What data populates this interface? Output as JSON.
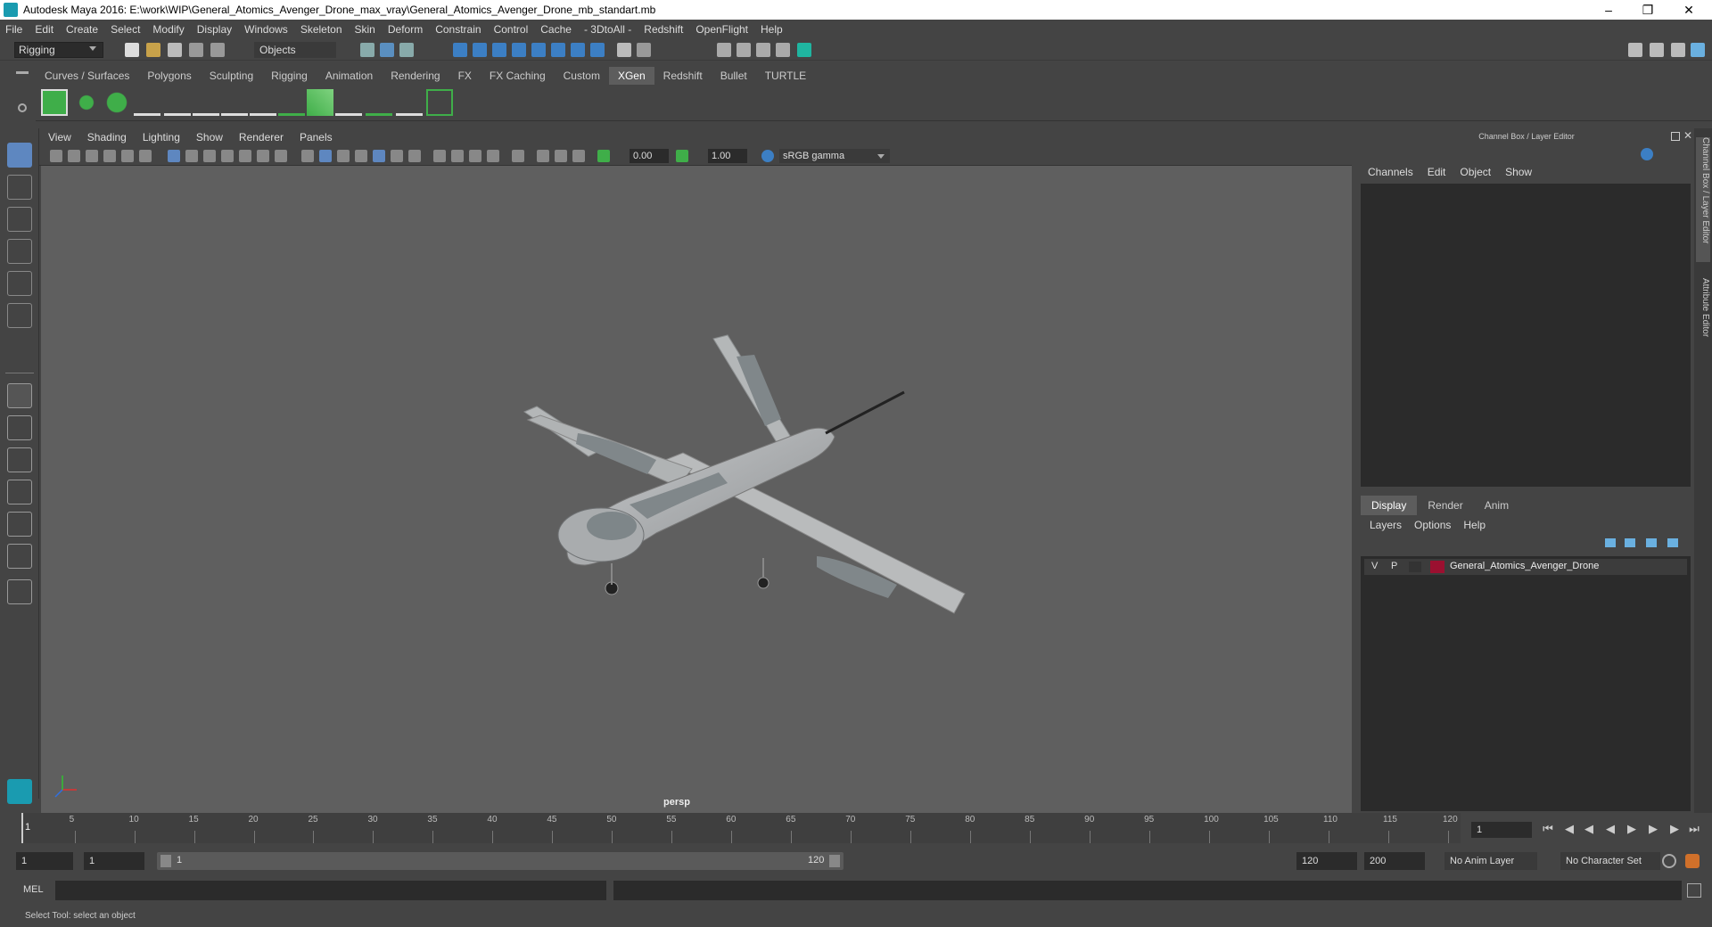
{
  "window": {
    "title": "Autodesk Maya 2016: E:\\work\\WIP\\General_Atomics_Avenger_Drone_max_vray\\General_Atomics_Avenger_Drone_mb_standart.mb"
  },
  "menubar": [
    "File",
    "Edit",
    "Create",
    "Select",
    "Modify",
    "Display",
    "Windows",
    "Skeleton",
    "Skin",
    "Deform",
    "Constrain",
    "Control",
    "Cache",
    "- 3DtoAll -",
    "Redshift",
    "OpenFlight",
    "Help"
  ],
  "statusline": {
    "mode": "Rigging",
    "objects_label": "Objects"
  },
  "shelf_tabs": [
    {
      "label": "Curves / Surfaces",
      "active": false
    },
    {
      "label": "Polygons",
      "active": false
    },
    {
      "label": "Sculpting",
      "active": false
    },
    {
      "label": "Rigging",
      "active": false
    },
    {
      "label": "Animation",
      "active": false
    },
    {
      "label": "Rendering",
      "active": false
    },
    {
      "label": "FX",
      "active": false
    },
    {
      "label": "FX Caching",
      "active": false
    },
    {
      "label": "Custom",
      "active": false
    },
    {
      "label": "XGen",
      "active": true
    },
    {
      "label": "Redshift",
      "active": false
    },
    {
      "label": "Bullet",
      "active": false
    },
    {
      "label": "TURTLE",
      "active": false
    }
  ],
  "viewport": {
    "menu": [
      "View",
      "Shading",
      "Lighting",
      "Show",
      "Renderer",
      "Panels"
    ],
    "exposure": "0.00",
    "gamma": "1.00",
    "colorspace": "sRGB gamma",
    "camera": "persp"
  },
  "right_panel": {
    "title": "Channel Box / Layer Editor",
    "menu": [
      "Channels",
      "Edit",
      "Object",
      "Show"
    ],
    "layer_tabs": [
      {
        "label": "Display",
        "active": true
      },
      {
        "label": "Render",
        "active": false
      },
      {
        "label": "Anim",
        "active": false
      }
    ],
    "layer_menu": [
      "Layers",
      "Options",
      "Help"
    ],
    "layer": {
      "v": "V",
      "p": "P",
      "name": "General_Atomics_Avenger_Drone",
      "color": "#9b1030"
    },
    "side_tabs": [
      "Channel Box / Layer Editor",
      "Attribute Editor"
    ]
  },
  "timeline": {
    "ticks": [
      "5",
      "10",
      "15",
      "20",
      "25",
      "30",
      "35",
      "40",
      "45",
      "50",
      "55",
      "60",
      "65",
      "70",
      "75",
      "80",
      "85",
      "90",
      "95",
      "100",
      "105",
      "110",
      "115",
      "120"
    ],
    "start_label": "1",
    "current_frame": "1"
  },
  "range": {
    "start": "1",
    "anim_start": "1",
    "slider_start": "1",
    "slider_end": "120",
    "anim_end": "120",
    "end": "200",
    "anim_layer": "No Anim Layer",
    "char_set": "No Character Set"
  },
  "command_line": {
    "label": "MEL"
  },
  "help_line": "Select Tool: select an object",
  "colors": {
    "accent_teal": "#1a9bb0",
    "active_tab": "#5d5d5d",
    "shelf_green": "#3fae49"
  }
}
